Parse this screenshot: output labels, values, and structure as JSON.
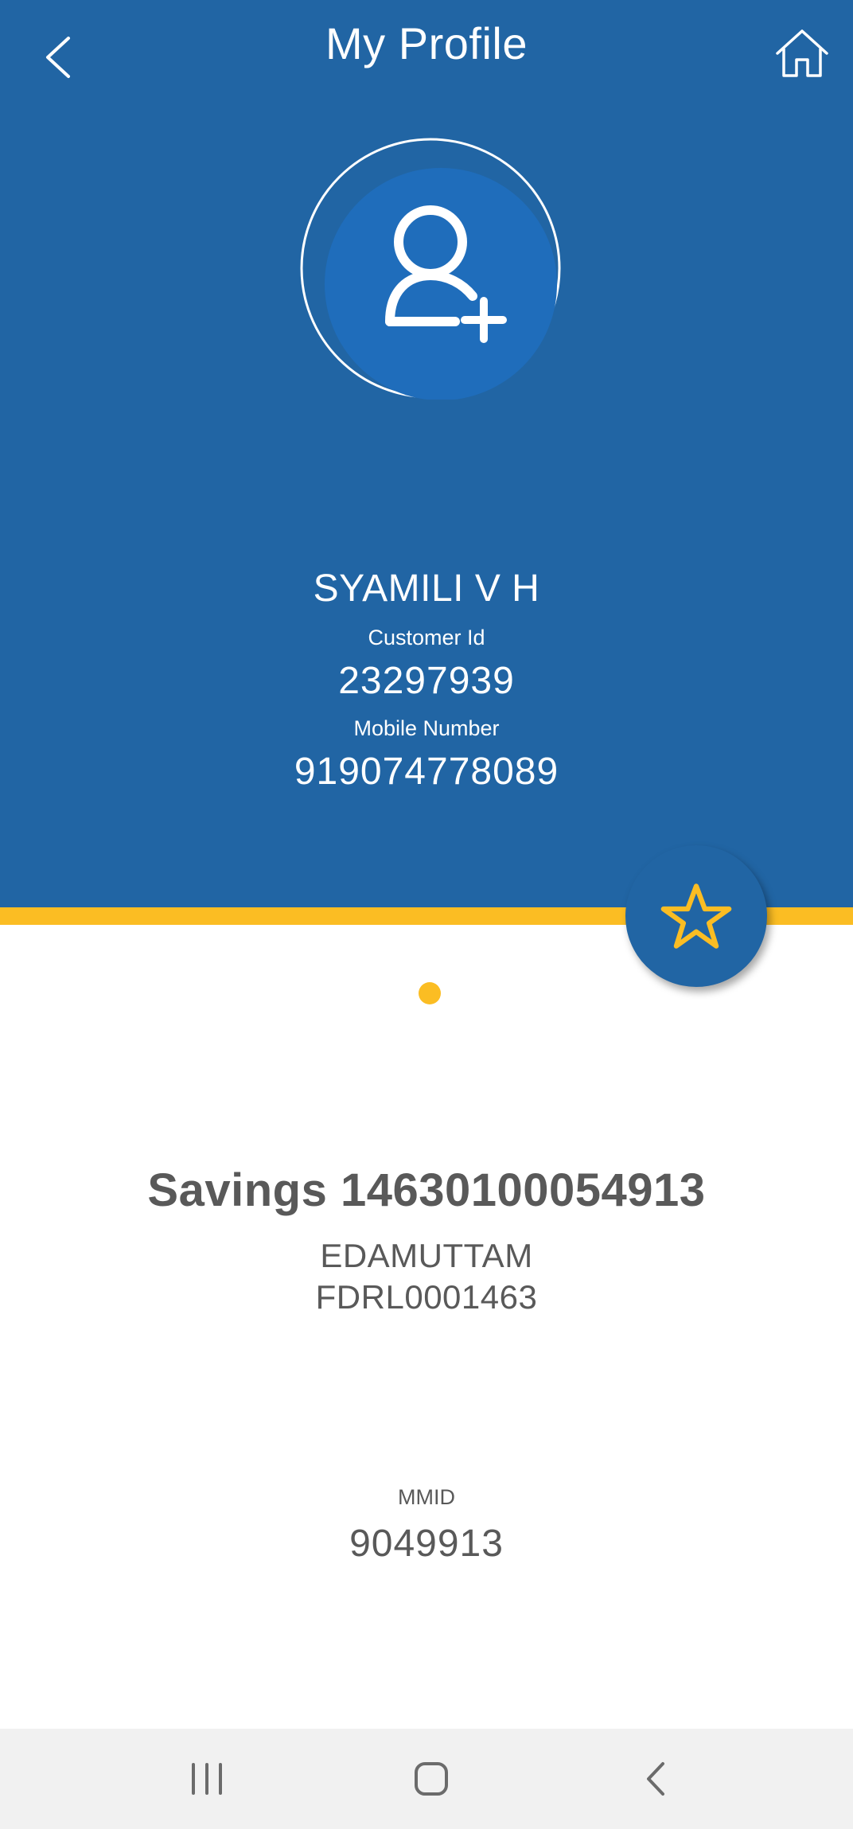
{
  "header": {
    "title": "My Profile",
    "back_icon": "chevron-left-icon",
    "home_icon": "home-icon"
  },
  "profile": {
    "avatar_icon": "add-user-icon",
    "name": "SYAMILI V H",
    "customer_id_label": "Customer Id",
    "customer_id": "23297939",
    "mobile_label": "Mobile Number",
    "mobile": "919074778089",
    "favorite_icon": "star-icon"
  },
  "account": {
    "carousel_pages": 1,
    "carousel_active_index": 0,
    "title": "Savings 14630100054913",
    "branch": "EDAMUTTAM",
    "ifsc": "FDRL0001463",
    "mmid_label": "MMID",
    "mmid": "9049913"
  },
  "system_nav": {
    "recent_icon": "recent-apps-icon",
    "home_icon": "home-square-icon",
    "back_icon": "back-chevron-icon"
  },
  "colors": {
    "primary": "#2165a4",
    "avatar_fill": "#1f6dbb",
    "accent": "#fbbd23",
    "text_dark": "#595959",
    "nav_bg": "#f1f1f1"
  }
}
